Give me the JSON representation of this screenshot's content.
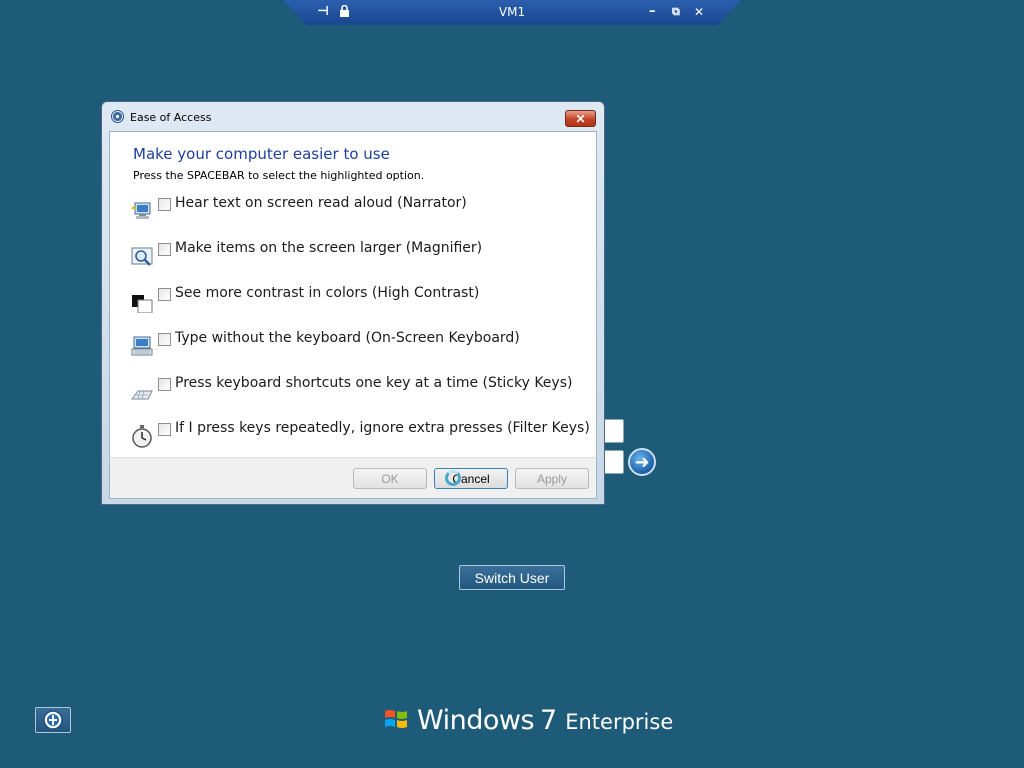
{
  "vm_bar": {
    "title": "VM1",
    "pin_icon": "pin-icon",
    "lock_icon": "lock-icon",
    "minimize_glyph": "–",
    "restore_glyph": "⧉",
    "close_glyph": "✕"
  },
  "dialog": {
    "title": "Ease of Access",
    "close_glyph": "✕",
    "heading": "Make your computer easier to use",
    "hint": "Press the SPACEBAR to select the highlighted option.",
    "options": [
      {
        "label": "Hear text on screen read aloud (Narrator)",
        "icon": "narrator-icon",
        "checked": false
      },
      {
        "label": "Make items on the screen larger (Magnifier)",
        "icon": "magnifier-icon",
        "checked": false
      },
      {
        "label": "See more contrast in colors (High Contrast)",
        "icon": "high-contrast-icon",
        "checked": false
      },
      {
        "label": "Type without the keyboard (On-Screen Keyboard)",
        "icon": "on-screen-keyboard-icon",
        "checked": false
      },
      {
        "label": "Press keyboard shortcuts one key at a time (Sticky Keys)",
        "icon": "sticky-keys-icon",
        "checked": false
      },
      {
        "label": "If I press keys repeatedly, ignore extra presses (Filter Keys)",
        "icon": "filter-keys-icon",
        "checked": false
      }
    ],
    "buttons": {
      "ok": "OK",
      "cancel": "Cancel",
      "apply": "Apply"
    }
  },
  "login": {
    "arrow_glyph": "➜",
    "switch_user": "Switch User"
  },
  "branding": {
    "windows": "Windows",
    "version": "7",
    "edition": "Enterprise"
  },
  "colors": {
    "desktop_bg": "#1e5b78",
    "heading_blue": "#1f3e9e"
  }
}
